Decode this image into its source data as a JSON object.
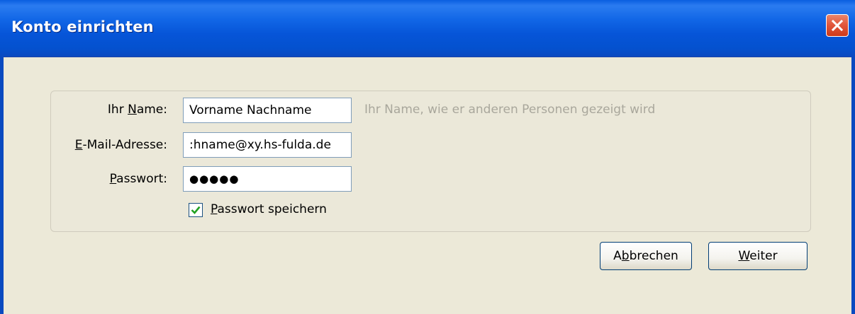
{
  "window": {
    "title": "Konto einrichten"
  },
  "form": {
    "name_label_pre": "Ihr ",
    "name_label_key": "N",
    "name_label_post": "ame:",
    "name_value": "Vorname Nachname",
    "name_hint": "Ihr Name, wie er anderen Personen gezeigt wird",
    "email_label_key": "E",
    "email_label_post": "-Mail-Adresse:",
    "email_value": ":hname@xy.hs-fulda.de",
    "password_label_key": "P",
    "password_label_post": "asswort:",
    "password_value": "●●●●●",
    "remember_checked": true,
    "remember_label_key": "P",
    "remember_label_post": "asswort speichern"
  },
  "buttons": {
    "cancel_pre": "A",
    "cancel_key": "b",
    "cancel_post": "brechen",
    "next_key": "W",
    "next_post": "eiter"
  },
  "colors": {
    "titlebar": "#0655d8",
    "window_bg": "#ece9d8",
    "close_button": "#e2583d",
    "hint_text": "#a9a79c"
  }
}
